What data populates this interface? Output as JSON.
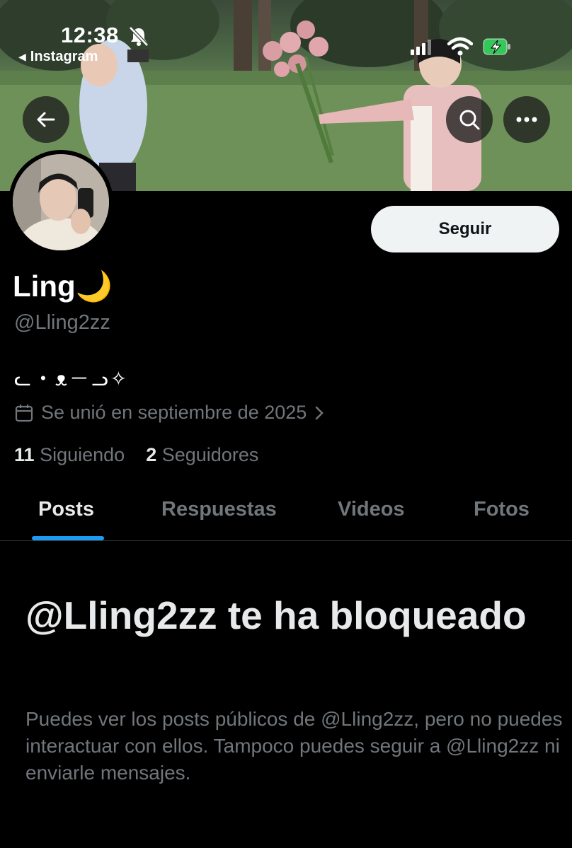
{
  "status_bar": {
    "time": "12:38",
    "back_app_label": "Instagram",
    "icons": [
      "bell-slash-icon",
      "signal-icon",
      "wifi-icon",
      "battery-charging-icon"
    ]
  },
  "header": {
    "back_icon": "arrow-left-icon",
    "search_icon": "search-icon",
    "more_icon": "more-horizontal-icon"
  },
  "profile": {
    "display_name": "Ling🌙",
    "handle": "@Lling2zz",
    "bio": "ᓚ・ᴥ－ᓗ✧",
    "joined": "Se unió en septiembre de 2025",
    "following_count": "11",
    "following_label": "Siguiendo",
    "followers_count": "2",
    "followers_label": "Seguidores",
    "follow_button": "Seguir"
  },
  "tabs": [
    {
      "label": "Posts",
      "active": true
    },
    {
      "label": "Respuestas",
      "active": false
    },
    {
      "label": "Videos",
      "active": false
    },
    {
      "label": "Fotos",
      "active": false
    }
  ],
  "blocked": {
    "title": "@Lling2zz te ha bloqueado",
    "message": "Puedes ver los posts públicos de @Lling2zz, pero no puedes interactuar con ellos. Tampoco puedes seguir a @Lling2zz ni enviarle mensajes."
  },
  "colors": {
    "accent": "#1d9bf0",
    "background": "#000000",
    "muted_text": "#71767b",
    "battery": "#34c759"
  }
}
